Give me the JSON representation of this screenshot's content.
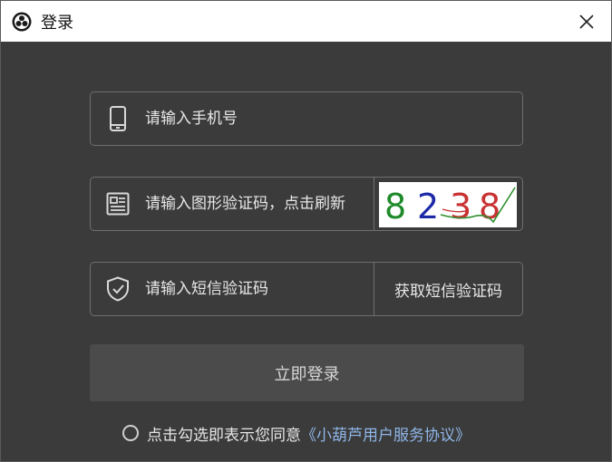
{
  "window": {
    "title": "登录",
    "close_icon": "close-icon",
    "logo_icon": "app-logo-icon"
  },
  "form": {
    "phone": {
      "placeholder": "请输入手机号",
      "icon": "phone-icon"
    },
    "image_captcha": {
      "placeholder": "请输入图形验证码，点击刷新",
      "icon": "document-icon",
      "captcha_text": [
        "8",
        "2",
        "3",
        "8"
      ],
      "captcha_colors": [
        "#1f8a2a",
        "#1d2aa6",
        "#c83232",
        "#c83232"
      ]
    },
    "sms_code": {
      "placeholder": "请输入短信验证码",
      "icon": "shield-check-icon",
      "button_label": "获取短信验证码"
    },
    "login_button": "立即登录"
  },
  "agreement": {
    "text": "点击勾选即表示您同意",
    "link": "《小葫芦用户服务协议》"
  },
  "colors": {
    "background": "#3b3b3b",
    "border": "#6f6f6f",
    "link": "#8fb6e8",
    "button": "#4b4b4b"
  }
}
